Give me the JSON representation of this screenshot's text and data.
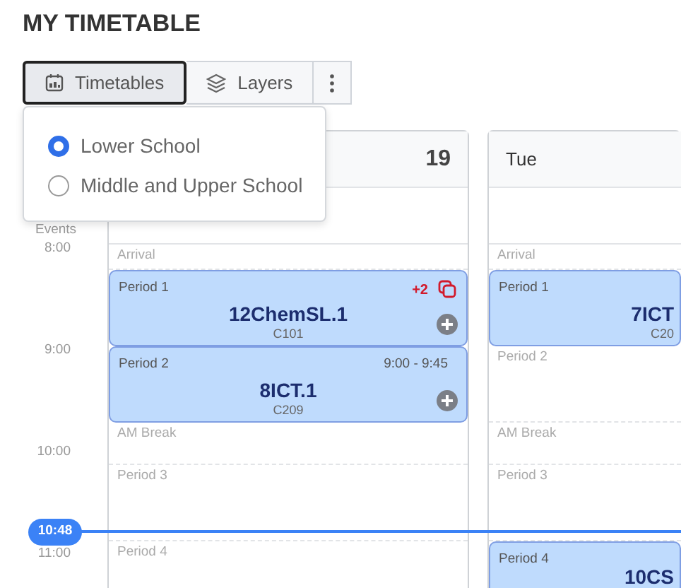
{
  "title": "MY TIMETABLE",
  "toolbar": [
    {
      "kind": "labeled",
      "label": "Timetables",
      "selected": true
    },
    {
      "kind": "labeled",
      "label": "Layers",
      "selected": false
    },
    {
      "kind": "menu",
      "selected": false
    }
  ],
  "dropdown": {
    "options": [
      {
        "label": "Lower School",
        "selected": true
      },
      {
        "label": "Middle and Upper School",
        "selected": false
      }
    ]
  },
  "all_day_label": "Events",
  "time_labels": [
    "8:00",
    "9:00",
    "10:00",
    "11:00"
  ],
  "now": "10:48",
  "days": [
    {
      "date": "19",
      "slots": [
        {
          "kind": "free",
          "label": "Arrival"
        },
        {
          "kind": "event",
          "label": "Period 1",
          "title": "12ChemSL.1",
          "room": "C101",
          "badge": "+2",
          "add": true
        },
        {
          "kind": "event",
          "label": "Period 2",
          "title": "8ICT.1",
          "room": "C209",
          "time": "9:00 - 9:45",
          "add": true
        },
        {
          "kind": "free",
          "label": "AM Break"
        },
        {
          "kind": "free",
          "label": "Period 3"
        },
        {
          "kind": "free",
          "label": "Period 4"
        }
      ]
    },
    {
      "name": "Tue",
      "slots": [
        {
          "kind": "free",
          "label": "Arrival"
        },
        {
          "kind": "event",
          "label": "Period 1",
          "title": "7ICT",
          "room": "C20",
          "add": false
        },
        {
          "kind": "free",
          "label": "Period 2"
        },
        {
          "kind": "free",
          "label": "AM Break"
        },
        {
          "kind": "free",
          "label": "Period 3"
        },
        {
          "kind": "event",
          "label": "Period 4",
          "title": "10CS",
          "add": false
        }
      ]
    }
  ]
}
